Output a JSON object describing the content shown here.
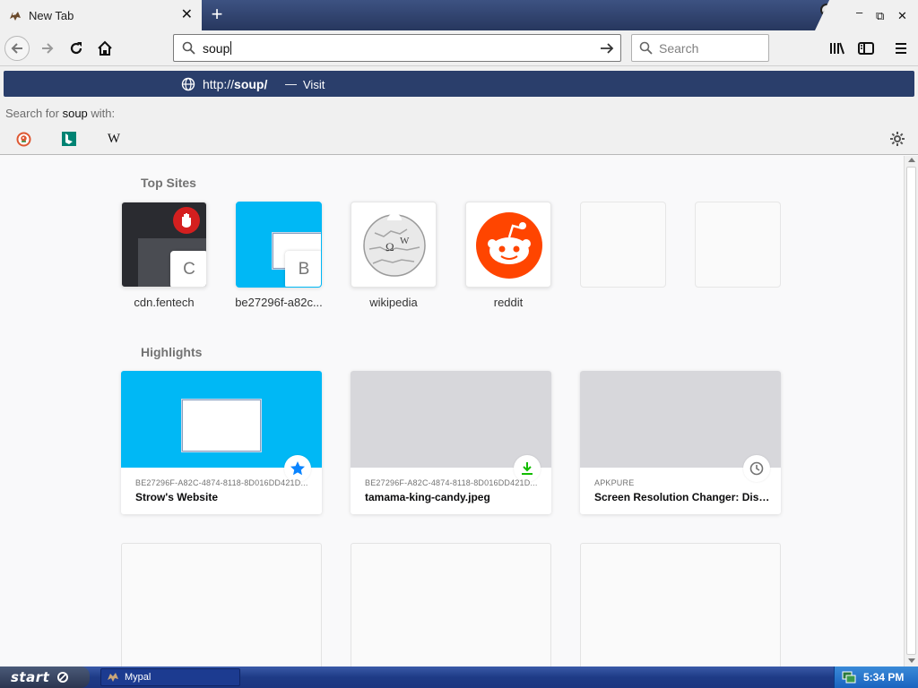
{
  "browser": {
    "tab": {
      "title": "New Tab",
      "favicon": "mypal-icon",
      "close_icon": "close-icon"
    },
    "new_tab_icon": "plus-icon",
    "window_controls": {
      "minimize": "minimize-icon",
      "restore": "restore-icon",
      "close": "close-icon"
    }
  },
  "navbar": {
    "back_icon": "back-arrow-icon",
    "forward_icon": "forward-arrow-icon",
    "reload_icon": "reload-icon",
    "home_icon": "home-icon",
    "url_value": "soup",
    "go_icon": "go-arrow-icon",
    "search_placeholder": "Search",
    "library_icon": "library-icon",
    "sidebar_icon": "sidebar-icon",
    "menu_icon": "hamburger-menu-icon"
  },
  "autocomplete": {
    "url_prefix": "http://",
    "url_bold": "soup/",
    "separator": "—",
    "action": "Visit",
    "search_for_prefix": "Search for ",
    "search_term": "soup",
    "search_for_suffix": " with:",
    "engines": [
      {
        "name": "duckduckgo-icon"
      },
      {
        "name": "bing-icon"
      },
      {
        "name": "wikipedia-icon",
        "glyph": "W"
      }
    ],
    "settings_icon": "gear-icon"
  },
  "newtab": {
    "top_sites_title": "Top Sites",
    "top_sites": [
      {
        "label": "cdn.fentech",
        "letter": "C"
      },
      {
        "label": "be27296f-a82c...",
        "letter": "B"
      },
      {
        "label": "wikipedia"
      },
      {
        "label": "reddit"
      }
    ],
    "highlights_title": "Highlights",
    "highlights": [
      {
        "source": "BE27296F-A82C-4874-8118-8D016DD421D...",
        "title": "Strow's Website",
        "badge": "star-icon",
        "accent": "#0a84ff"
      },
      {
        "source": "BE27296F-A82C-4874-8118-8D016DD421D...",
        "title": "tamama-king-candy.jpeg",
        "badge": "download-icon",
        "accent": "#12bc00"
      },
      {
        "source": "APKPURE",
        "title": "Screen Resolution Changer: Disp...",
        "badge": "clock-icon",
        "accent": "#737373"
      }
    ]
  },
  "taskbar": {
    "start_label": "start",
    "task_label": "Mypal",
    "clock": "5:34 PM"
  },
  "colors": {
    "titlebar": "#27375e",
    "suggestion_bg": "#2a3e6b",
    "tile_cyan": "#00b8f5",
    "reddit": "#ff4500"
  }
}
